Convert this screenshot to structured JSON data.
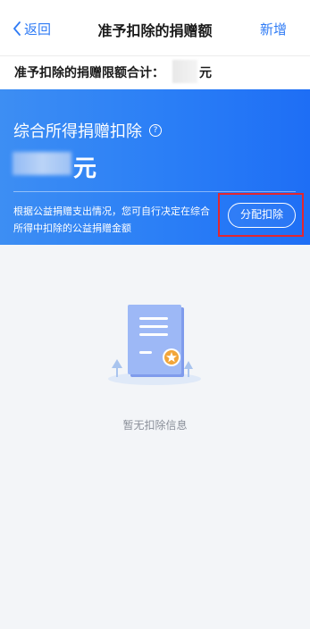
{
  "navbar": {
    "back_label": "返回",
    "title": "准予扣除的捐赠额",
    "add_label": "新增"
  },
  "limit": {
    "label": "准予扣除的捐赠限额合计：",
    "unit": "元"
  },
  "banner": {
    "title": "综合所得捐赠扣除",
    "amount_unit": "元",
    "description": "根据公益捐赠支出情况，您可自行决定在综合所得中扣除的公益捐赠金额",
    "allocate_button": "分配扣除"
  },
  "empty_state": {
    "message": "暂无扣除信息"
  },
  "colors": {
    "accent": "#2f7bf5",
    "banner": "#2a7ef6",
    "highlight": "#e3262f"
  }
}
